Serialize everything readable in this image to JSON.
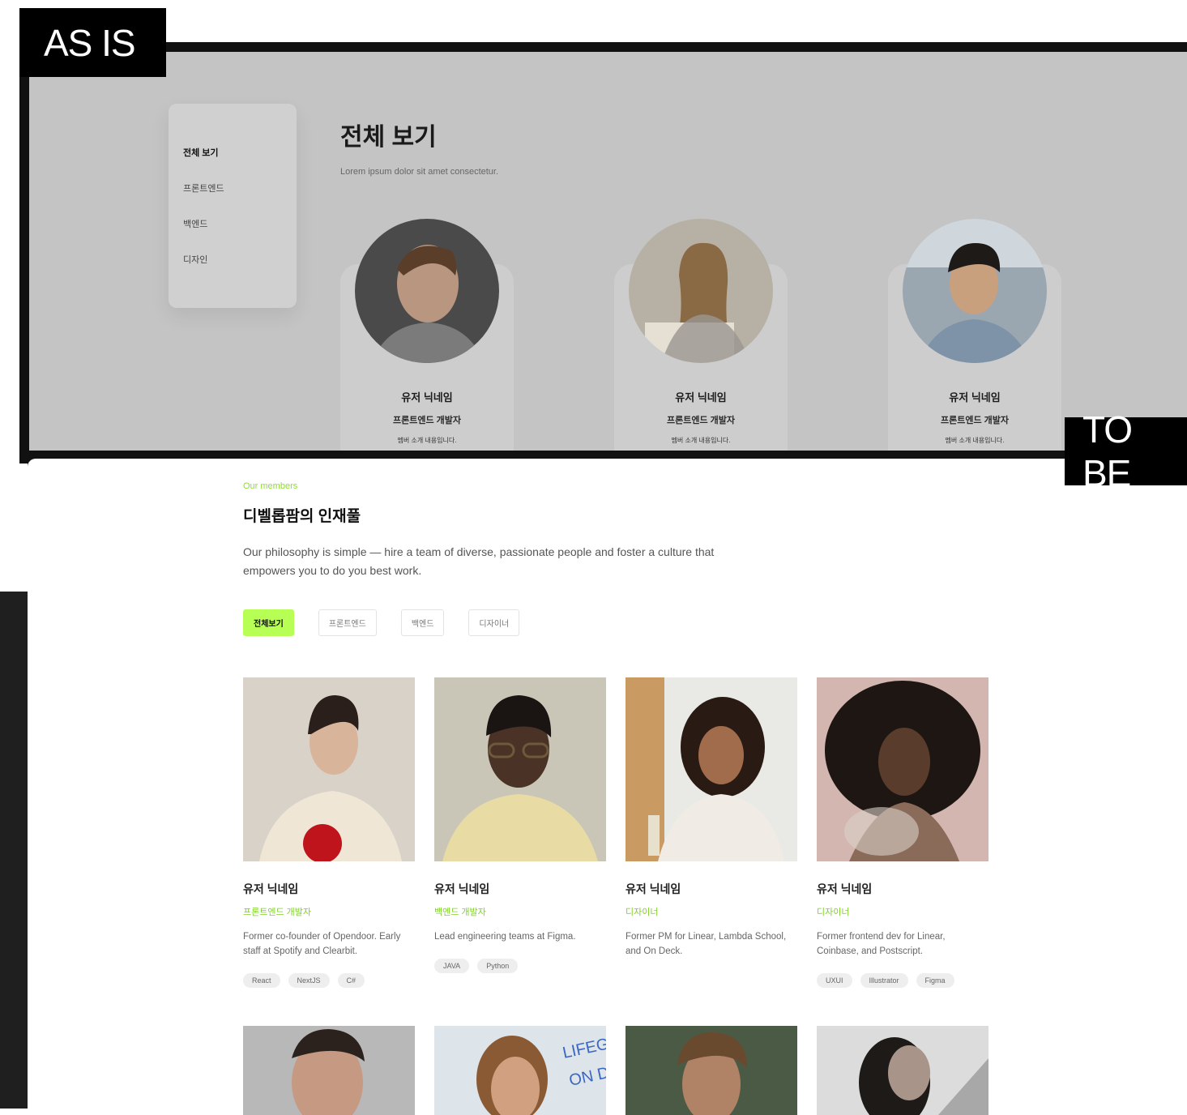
{
  "labels": {
    "as_is": "AS IS",
    "to_be": "TO BE"
  },
  "as_is": {
    "sidebar": [
      "전체 보기",
      "프론트엔드",
      "백엔드",
      "디자인"
    ],
    "title": "전체 보기",
    "subtitle": "Lorem ipsum dolor sit amet consectetur.",
    "cards": [
      {
        "name": "유저 닉네임",
        "role": "프론트엔드 개발자",
        "desc": "멤버 소개 내용입니다."
      },
      {
        "name": "유저 닉네임",
        "role": "프론트엔드 개발자",
        "desc": "멤버 소개 내용입니다."
      },
      {
        "name": "유저 닉네임",
        "role": "프론트엔드 개발자",
        "desc": "멤버 소개 내용입니다."
      }
    ]
  },
  "to_be": {
    "eyebrow": "Our members",
    "title": "디벨롭팜의 인재풀",
    "description": "Our philosophy is simple — hire a team of diverse, passionate people and foster a culture that empowers you to do you best work.",
    "filters": [
      "전체보기",
      "프론트엔드",
      "백엔드",
      "디자이너"
    ],
    "members": [
      {
        "name": "유저 닉네임",
        "role": "프론트엔드 개발자",
        "desc": "Former co-founder of Opendoor. Early staff at Spotify and Clearbit.",
        "tags": [
          "React",
          "NextJS",
          "C#"
        ]
      },
      {
        "name": "유저 닉네임",
        "role": "백엔드 개발자",
        "desc": "Lead engineering teams at Figma.",
        "tags": [
          "JAVA",
          "Python"
        ]
      },
      {
        "name": "유저 닉네임",
        "role": "디자이너",
        "desc": "Former PM for Linear, Lambda School, and On Deck.",
        "tags": []
      },
      {
        "name": "유저 닉네임",
        "role": "디자이너",
        "desc": "Former frontend dev for Linear, Coinbase, and Postscript.",
        "tags": [
          "UXUI",
          "Illustrator",
          "Figma"
        ]
      }
    ]
  },
  "colors": {
    "accent": "#b8ff55",
    "accent_text": "#7ed321",
    "frame": "#111111",
    "asis_bg": "#c4c4c4"
  }
}
